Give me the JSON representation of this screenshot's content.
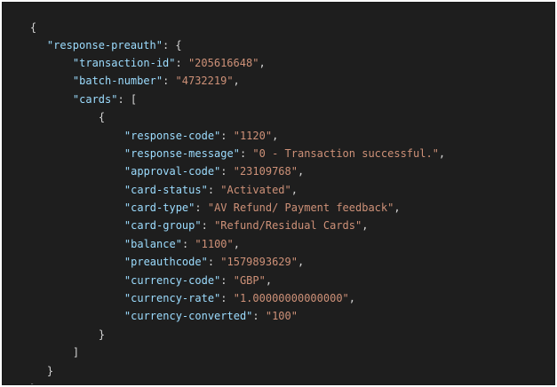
{
  "json_viewer": {
    "root": {
      "open_brace": "{",
      "close_brace": "}"
    },
    "response_preauth": {
      "key": "\"response-preauth\"",
      "open": ": {",
      "close": "}"
    },
    "fields": {
      "transaction_id": {
        "key": "\"transaction-id\"",
        "value": "\"205616648\""
      },
      "batch_number": {
        "key": "\"batch-number\"",
        "value": "\"4732219\""
      }
    },
    "cards": {
      "key": "\"cards\"",
      "open": ": [",
      "close": "]",
      "item_open": "{",
      "item_close": "}",
      "entries": [
        {
          "key": "\"response-code\"",
          "value": "\"1120\""
        },
        {
          "key": "\"response-message\"",
          "value": "\"0 - Transaction successful.\""
        },
        {
          "key": "\"approval-code\"",
          "value": "\"23109768\""
        },
        {
          "key": "\"card-status\"",
          "value": "\"Activated\""
        },
        {
          "key": "\"card-type\"",
          "value": "\"AV Refund/ Payment feedback\""
        },
        {
          "key": "\"card-group\"",
          "value": "\"Refund/Residual Cards\""
        },
        {
          "key": "\"balance\"",
          "value": "\"1100\""
        },
        {
          "key": "\"preauthcode\"",
          "value": "\"1579893629\""
        },
        {
          "key": "\"currency-code\"",
          "value": "\"GBP\""
        },
        {
          "key": "\"currency-rate\"",
          "value": "\"1.00000000000000\""
        },
        {
          "key": "\"currency-converted\"",
          "value": "\"100\""
        }
      ]
    },
    "punctuation": {
      "colon": ": ",
      "comma": ","
    },
    "colors": {
      "background": "#1e1e1e",
      "key": "#9cdcfe",
      "string": "#ce9178",
      "punctuation": "#d4d4d4"
    }
  }
}
